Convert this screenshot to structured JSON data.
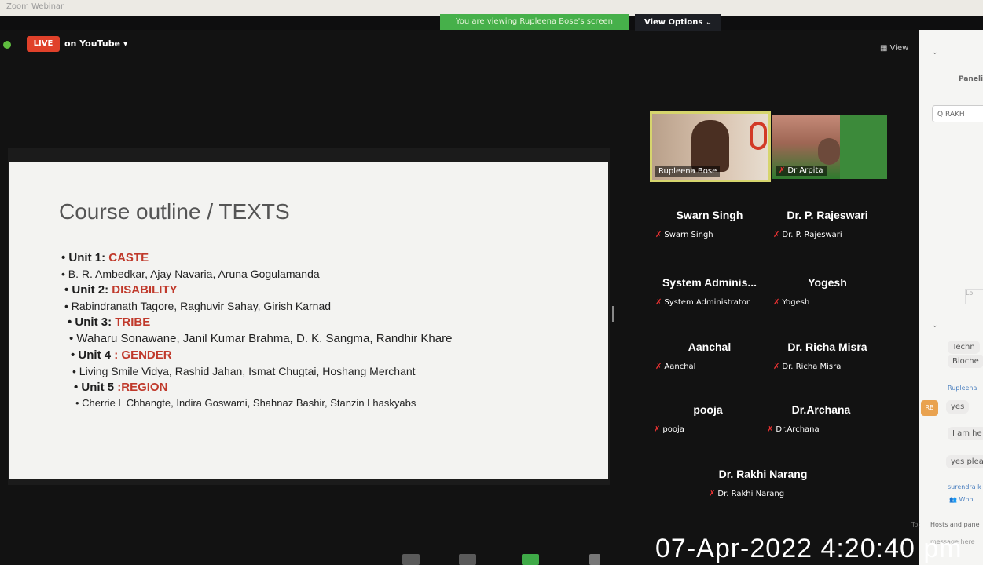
{
  "window": {
    "title": "Zoom Webinar"
  },
  "banner": {
    "viewing": "You are viewing Rupleena Bose's screen",
    "view_options": "View Options ⌄"
  },
  "stream": {
    "live": "LIVE",
    "platform": "on YouTube ▾"
  },
  "view_button": "▦ View",
  "slide": {
    "title": "Course outline / TEXTS",
    "lines": [
      {
        "label": "Unit 1: ",
        "topic": "CASTE"
      },
      {
        "authors": "B. R. Ambedkar, Ajay Navaria, Aruna Gogulamanda"
      },
      {
        "label": "Unit 2: ",
        "topic": "DISABILITY"
      },
      {
        "authors": "Rabindranath Tagore, Raghuvir Sahay, Girish Karnad"
      },
      {
        "label": "Unit 3: ",
        "topic": "TRIBE"
      },
      {
        "authors": "Waharu Sonawane, Janil Kumar Brahma, D. K. Sangma, Randhir Khare"
      },
      {
        "label": "Unit 4 ",
        "topic": ": GENDER"
      },
      {
        "authors": "Living Smile Vidya, Rashid Jahan, Ismat Chugtai, Hoshang Merchant"
      },
      {
        "label": "Unit 5 ",
        "topic": ":REGION"
      },
      {
        "authors": "Cherrie L Chhangte, Indira Goswami, Shahnaz Bashir, Stanzin Lhaskyabs"
      }
    ]
  },
  "video_tiles": [
    {
      "name": "Rupleena Bose"
    },
    {
      "name": "Dr Arpita"
    }
  ],
  "participants": [
    {
      "display": "Swarn Singh",
      "label": "Swarn Singh"
    },
    {
      "display": "Dr. P. Rajeswari",
      "label": "Dr. P. Rajeswari"
    },
    {
      "display": "System Adminis...",
      "label": "System Administrator"
    },
    {
      "display": "Yogesh",
      "label": "Yogesh"
    },
    {
      "display": "Aanchal",
      "label": "Aanchal"
    },
    {
      "display": "Dr. Richa Misra",
      "label": "Dr. Richa Misra"
    },
    {
      "display": "pooja",
      "label": "pooja"
    },
    {
      "display": "Dr.Archana",
      "label": "Dr.Archana"
    },
    {
      "display": "Dr. Rakhi Narang",
      "label": "Dr. Rakhi Narang"
    }
  ],
  "side_panel": {
    "panel_label": "Paneli",
    "search_value": "Q RAKH",
    "side_button": "Lo",
    "chat": {
      "msg1": "Techn",
      "msg1b": "Bioche",
      "sender": "Rupleena",
      "avatar": "RB",
      "msg2": "yes",
      "msg3": "I am he",
      "msg4": "yes plea",
      "partial": "surendra k",
      "who": "Who",
      "to_label": "To:",
      "recipient": "Hosts and pane",
      "placeholder": "message here"
    }
  },
  "timestamp": "07-Apr-2022 4:20:40 pm",
  "colors": {
    "accent_green": "#46b04a",
    "live_red": "#e0412a",
    "topic_red": "#c0392b"
  }
}
